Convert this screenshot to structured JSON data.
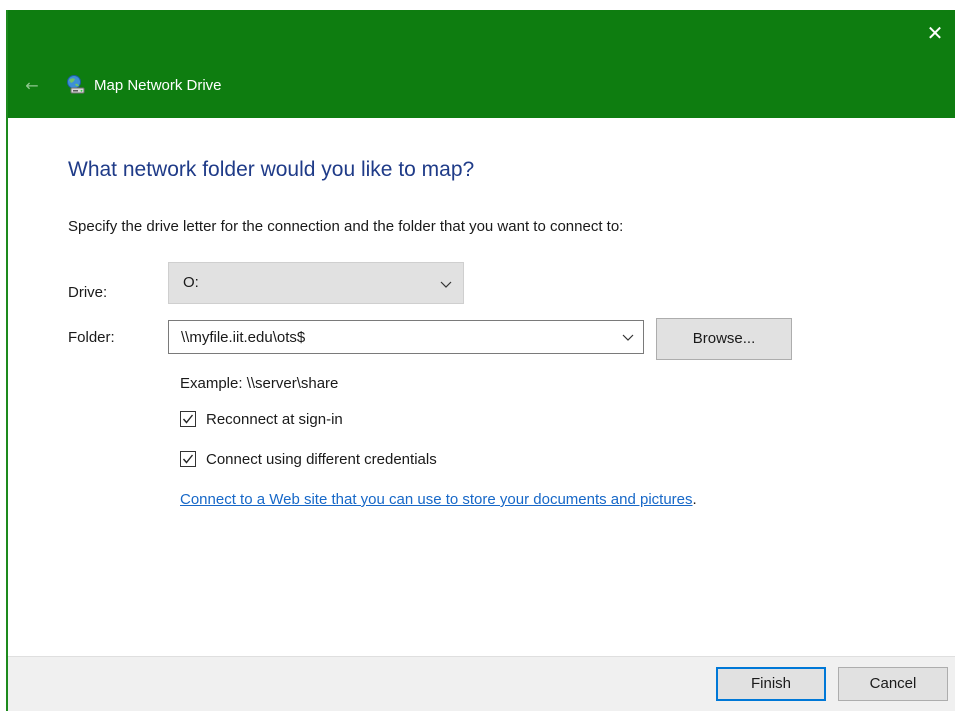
{
  "window": {
    "title": "Map Network Drive",
    "close_glyph": "✕",
    "back_glyph": "←",
    "titlebar_color": "#0e7d10"
  },
  "heading": "What network folder would you like to map?",
  "instructions": "Specify the drive letter for the connection and the folder that you want to connect to:",
  "drive": {
    "label": "Drive:",
    "value": "O:"
  },
  "folder": {
    "label": "Folder:",
    "value": "\\\\myfile.iit.edu\\ots$",
    "browse_label": "Browse..."
  },
  "example": "Example: \\\\server\\share",
  "options": {
    "reconnect": {
      "label": "Reconnect at sign-in",
      "checked": true
    },
    "credentials": {
      "label": "Connect using different credentials",
      "checked": true
    }
  },
  "web_link": {
    "text": "Connect to a Web site that you can use to store your documents and pictures",
    "suffix": "."
  },
  "footer": {
    "finish_label": "Finish",
    "cancel_label": "Cancel"
  },
  "icons": {
    "app": "network-drive-icon",
    "back": "back-arrow-icon",
    "close": "close-icon",
    "dropdown": "chevron-down-icon",
    "check": "checkmark-icon"
  },
  "colors": {
    "heading": "#1f3b88",
    "link": "#1768c8",
    "focus_border": "#0078d7"
  }
}
